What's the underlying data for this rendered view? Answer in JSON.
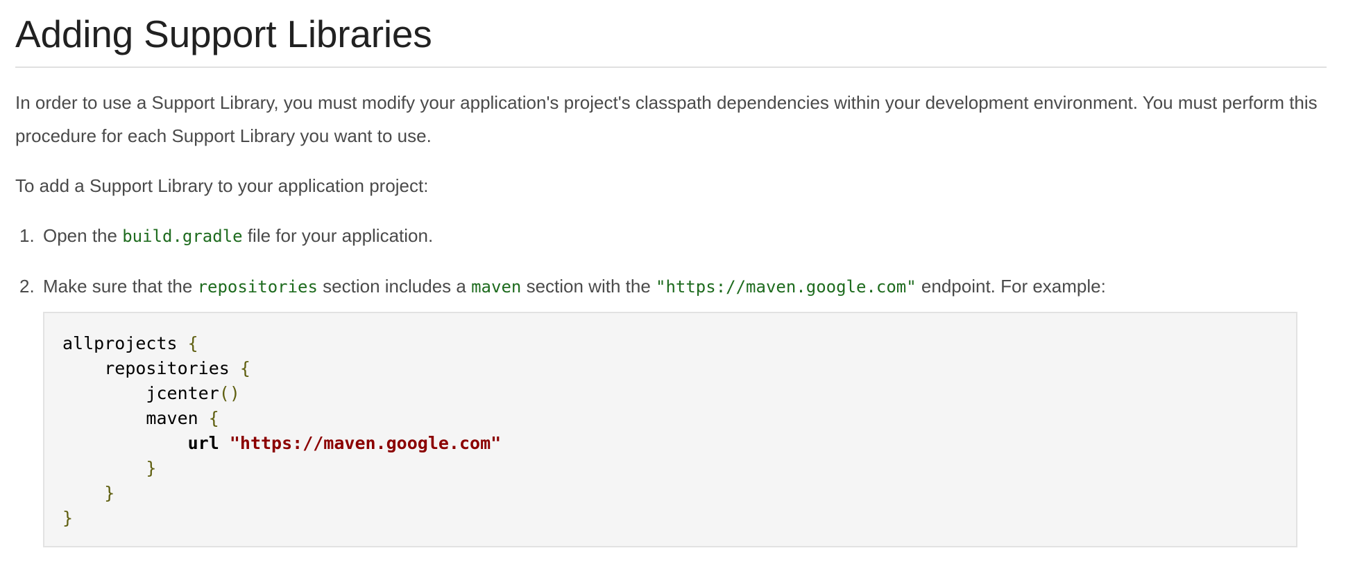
{
  "heading": "Adding Support Libraries",
  "paragraphs": {
    "intro": "In order to use a Support Library, you must modify your application's project's classpath dependencies within your development environment. You must perform this procedure for each Support Library you want to use.",
    "lead": "To add a Support Library to your application project:"
  },
  "steps": [
    {
      "number": "1.",
      "text_before": "Open the ",
      "code": "build.gradle",
      "text_after": " file for your application."
    },
    {
      "number": "2.",
      "text_a": "Make sure that the ",
      "code_a": "repositories",
      "text_b": " section includes a ",
      "code_b": "maven",
      "text_c": " section with the ",
      "code_c": "\"https://maven.google.com\"",
      "text_d": " endpoint. For example:"
    }
  ],
  "code_block": {
    "l1_ident": "allprojects",
    "l2_ident": "repositories",
    "l3_ident": "jcenter",
    "l4_ident": "maven",
    "l5_keyword": "url",
    "l5_string": "\"https://maven.google.com\"",
    "open_brace": "{",
    "close_brace": "}",
    "parens": "()"
  },
  "colors": {
    "text": "#4a4a4a",
    "heading": "#212121",
    "inline_code": "#1e6b1e",
    "code_bg": "#f5f5f5",
    "string": "#8b0000",
    "punctuation": "#5f5f10"
  }
}
